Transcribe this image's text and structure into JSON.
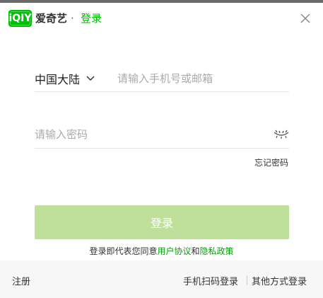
{
  "header": {
    "logo_text": "iQIY",
    "brand": "爱奇艺",
    "separator": "·",
    "title": "登录"
  },
  "form": {
    "region": "中国大陆",
    "phone_placeholder": "请输入手机号或邮箱",
    "password_placeholder": "请输入密码",
    "forgot_password": "忘记密码",
    "login_button": "登录"
  },
  "agreement": {
    "prefix": "登录即代表您同意",
    "user_agreement": "用户协议",
    "and": "和",
    "privacy_policy": "隐私政策"
  },
  "footer": {
    "register": "注册",
    "qr_login": "手机扫码登录",
    "other_login": "其他方式登录"
  },
  "colors": {
    "brand_green": "#00be06",
    "link_green": "#00a107",
    "button_disabled": "#bfe09b",
    "footer_bg": "#f7f7f7"
  },
  "icons": {
    "close": "close-icon",
    "region_dropdown": "chevron-down-icon",
    "password_visibility": "eye-closed-icon"
  }
}
